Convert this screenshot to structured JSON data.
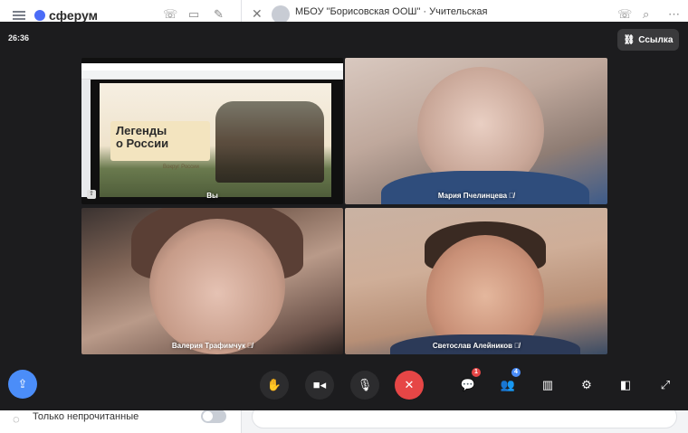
{
  "app": {
    "logo": "сферум",
    "chat_title": "МБОУ \"Борисовская ООШ\" · Учительская",
    "chat_subtitle": "",
    "unread_filter_label": "Только непрочитанные"
  },
  "call": {
    "timer": "26:36",
    "link_button_label": "Ссылка",
    "participants": [
      {
        "name": "Вы",
        "muted": false
      },
      {
        "name": "Мария Пчелинцева",
        "muted": true
      },
      {
        "name": "Валерия Трафимчук",
        "muted": true
      },
      {
        "name": "Светослав Алейников",
        "muted": true
      }
    ],
    "shared_screen": {
      "slide_title_line1": "Легенды",
      "slide_title_line2": "о России",
      "slide_logo": "Вокруг России"
    },
    "controls": [
      {
        "name": "raise-hand",
        "icon": "hand-icon"
      },
      {
        "name": "camera",
        "icon": "camera-icon"
      },
      {
        "name": "microphone",
        "icon": "microphone-icon"
      },
      {
        "name": "end-call",
        "icon": "close-icon"
      },
      {
        "name": "chat",
        "icon": "chat-icon",
        "badge": "1"
      },
      {
        "name": "participants",
        "icon": "people-icon",
        "badge": "4"
      },
      {
        "name": "layout",
        "icon": "grid-icon"
      },
      {
        "name": "settings",
        "icon": "gear-icon"
      },
      {
        "name": "picture-in-picture",
        "icon": "pip-icon"
      },
      {
        "name": "fullscreen",
        "icon": "expand-icon"
      }
    ]
  },
  "colors": {
    "accent": "#4b8df8",
    "end_call": "#e64646",
    "overlay_bg": "#1c1c1e"
  }
}
